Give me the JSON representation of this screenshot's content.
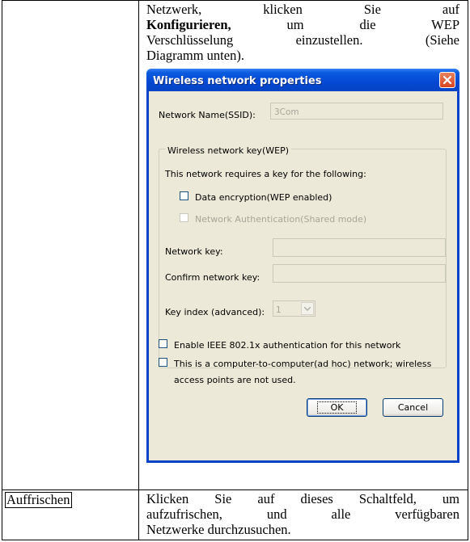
{
  "table": {
    "row1": {
      "term": "",
      "description": {
        "line1": "Netzwerk, klicken Sie auf",
        "bold": "Konfigurieren,",
        "line2_rest": "um die WEP",
        "line3": "Verschlüsselung einzustellen. (Siehe",
        "line4": "Diagramm unten)."
      }
    },
    "row2": {
      "term": "Auffrischen",
      "description": {
        "line1": "Klicken Sie auf dieses Schaltfeld, um",
        "line2": "aufzufrischen, und alle verfügbaren",
        "line3": "Netzwerke durchzusuchen."
      }
    }
  },
  "dialog": {
    "title": "Wireless network properties",
    "network_name_label": "Network Name(SSID):",
    "network_name_value": "3Com",
    "group_title": "Wireless network key(WEP)",
    "requires_key_text": "This network requires a key for the following:",
    "data_encryption_label": "Data encryption(WEP enabled)",
    "network_auth_label": "Network Authentication(Shared mode)",
    "network_key_label": "Network key:",
    "network_key_value": "",
    "confirm_key_label": "Confirm network key:",
    "confirm_key_value": "",
    "key_index_label": "Key index (advanced):",
    "key_index_value": "1",
    "ieee_label": "Enable IEEE 802.1x authentication for this network",
    "adhoc_label_line1": "This is a computer-to-computer(ad hoc) network; wireless",
    "adhoc_label_line2": "access points are not used.",
    "ok_label": "OK",
    "cancel_label": "Cancel"
  }
}
